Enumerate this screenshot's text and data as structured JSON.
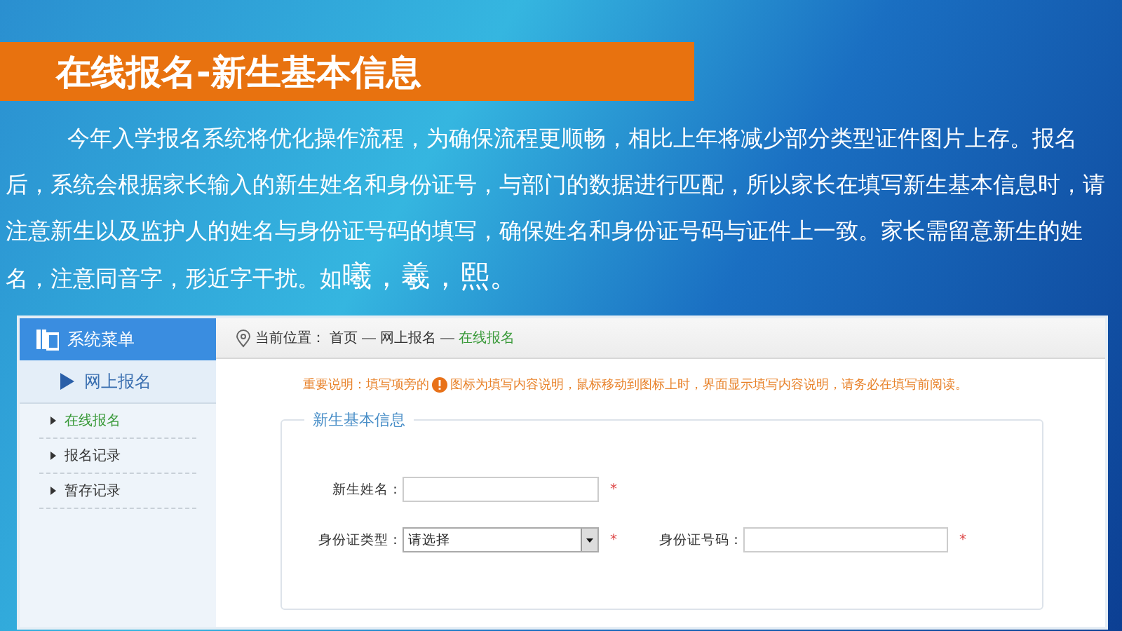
{
  "slide_title": "在线报名-新生基本信息",
  "body": {
    "text": "今年入学报名系统将优化操作流程，为确保流程更顺畅，相比上年将减少部分类型证件图片上存。报名后，系统会根据家长输入的新生姓名和身份证号，与部门的数据进行匹配，所以家长在填写新生基本信息时，请注意新生以及监护人的姓名与身份证号码的填写，确保姓名和身份证号码与证件上一致。家长需留意新生的姓名，注意同音字，形近字干扰。如",
    "examples": "曦，羲，熙。"
  },
  "sidebar": {
    "title": "系统菜单",
    "section": "网上报名",
    "items": [
      {
        "label": "在线报名",
        "selected": true
      },
      {
        "label": "报名记录",
        "selected": false
      },
      {
        "label": "暂存记录",
        "selected": false
      }
    ]
  },
  "breadcrumb": {
    "label": "当前位置：",
    "items": [
      {
        "text": "首页",
        "current": false
      },
      {
        "text": "网上报名",
        "current": false
      },
      {
        "text": "在线报名",
        "current": true
      }
    ]
  },
  "notice": {
    "before": "重要说明：填写项旁的",
    "after": "图标为填写内容说明，鼠标移动到图标上时，界面显示填写内容说明，请务必在填写前阅读。"
  },
  "form": {
    "legend": "新生基本信息",
    "rows": [
      [
        {
          "kind": "input",
          "label": "新生姓名：",
          "required_mark": "*"
        }
      ],
      [
        {
          "kind": "select",
          "label": "身份证类型：",
          "value": "请选择",
          "required_mark": "*"
        },
        {
          "kind": "input",
          "label": "身份证号码：",
          "required_mark": "*"
        }
      ]
    ]
  }
}
